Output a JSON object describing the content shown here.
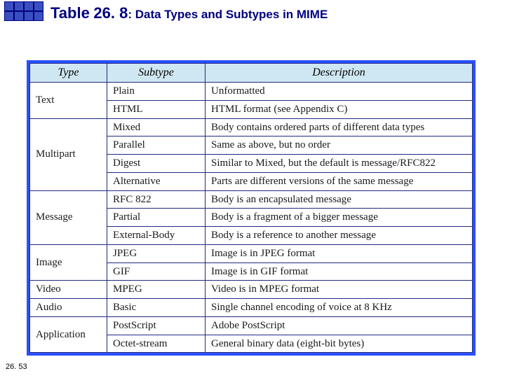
{
  "title": {
    "prefix": "Table",
    "number": "26. 8",
    "rest": ": Data Types and Subtypes in MIME"
  },
  "footer": "26. 53",
  "table": {
    "headers": {
      "type": "Type",
      "subtype": "Subtype",
      "description": "Description"
    },
    "groups": [
      {
        "type": "Text",
        "rows": [
          {
            "subtype": "Plain",
            "description": "Unformatted"
          },
          {
            "subtype": "HTML",
            "description": "HTML format (see Appendix C)"
          }
        ]
      },
      {
        "type": "Multipart",
        "rows": [
          {
            "subtype": "Mixed",
            "description": "Body contains ordered parts of different data types"
          },
          {
            "subtype": "Parallel",
            "description": "Same as above, but no order"
          },
          {
            "subtype": "Digest",
            "description": "Similar to Mixed, but the default is message/RFC822"
          },
          {
            "subtype": "Alternative",
            "description": "Parts are different versions of the same message"
          }
        ]
      },
      {
        "type": "Message",
        "rows": [
          {
            "subtype": "RFC 822",
            "description": "Body is an encapsulated message"
          },
          {
            "subtype": "Partial",
            "description": "Body is a fragment of a bigger message"
          },
          {
            "subtype": "External-Body",
            "description": "Body is a reference to another message"
          }
        ]
      },
      {
        "type": "Image",
        "rows": [
          {
            "subtype": "JPEG",
            "description": "Image is in JPEG format"
          },
          {
            "subtype": "GIF",
            "description": "Image is in GIF format"
          }
        ]
      },
      {
        "type": "Video",
        "rows": [
          {
            "subtype": "MPEG",
            "description": "Video is in MPEG format"
          }
        ]
      },
      {
        "type": "Audio",
        "rows": [
          {
            "subtype": "Basic",
            "description": "Single channel encoding of voice at 8 KHz"
          }
        ]
      },
      {
        "type": "Application",
        "rows": [
          {
            "subtype": "PostScript",
            "description": "Adobe PostScript"
          },
          {
            "subtype": "Octet-stream",
            "description": "General binary data (eight-bit bytes)"
          }
        ]
      }
    ]
  }
}
